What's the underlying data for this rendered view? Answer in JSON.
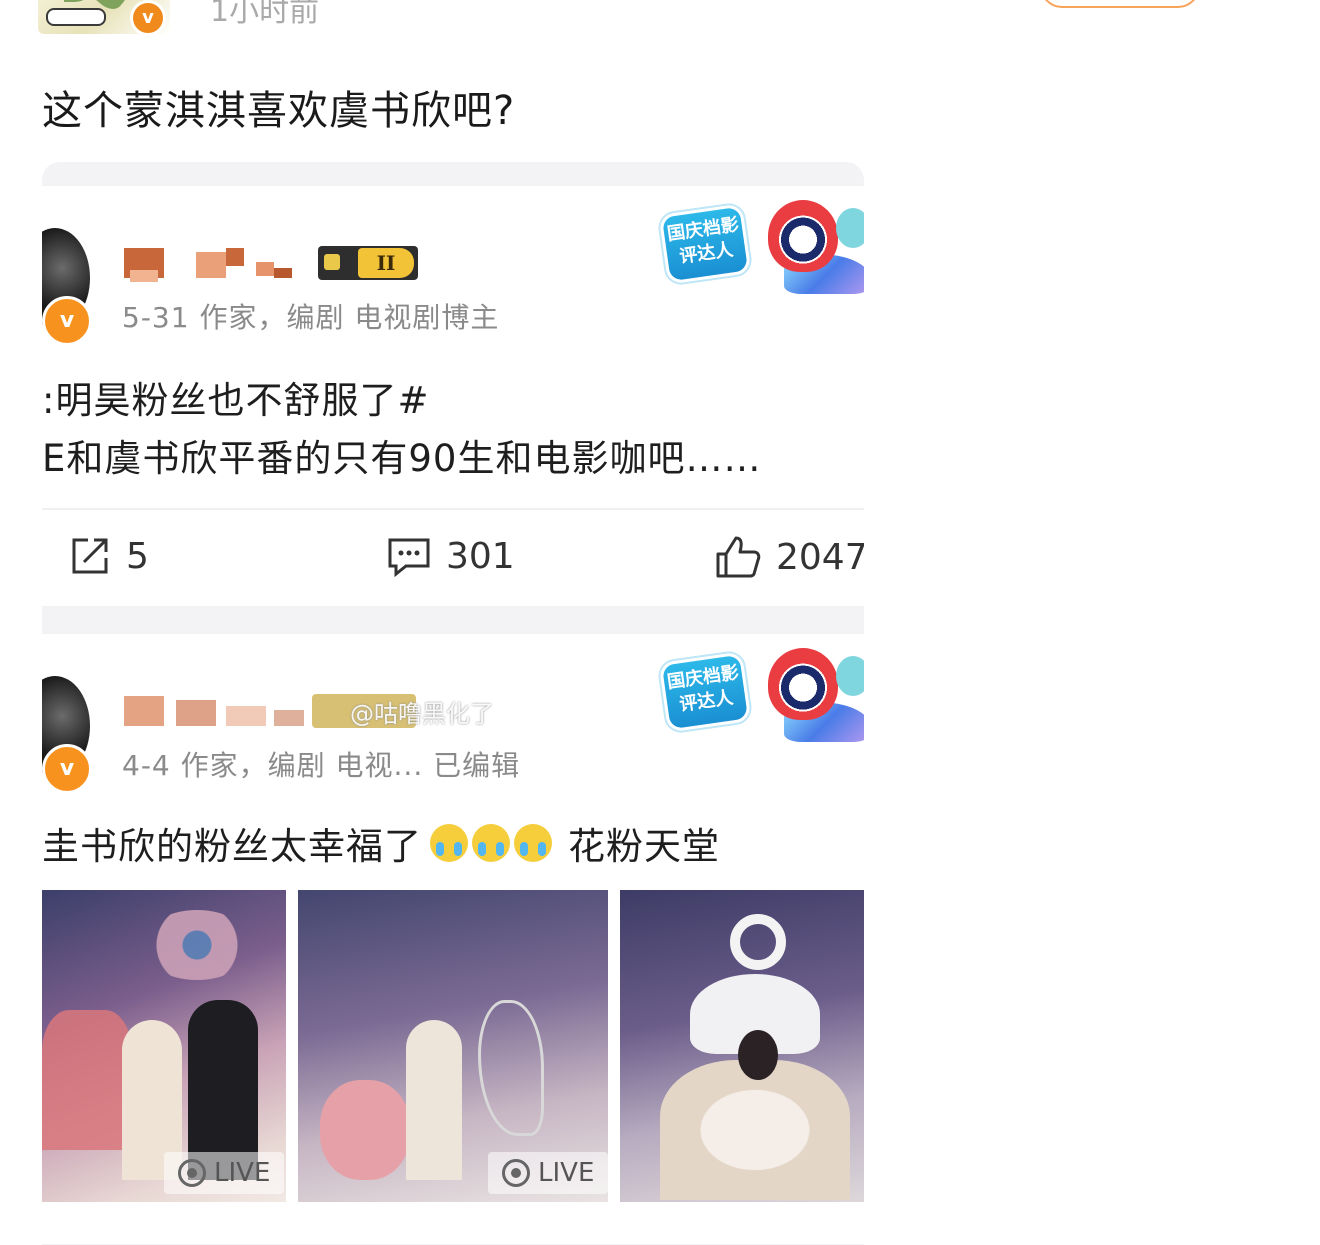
{
  "outer": {
    "time": "1小时前",
    "post_text": "这个蒙淇淇喜欢虞书欣吧?"
  },
  "screenshot": {
    "post1": {
      "meta": "5-31  作家，编剧 电视剧博主",
      "line1": ":明昊粉丝也不舒服了#",
      "line2": "E和虞书欣平番的只有90生和电影咖吧……",
      "badge_text": "国庆档影评达人",
      "level": "II",
      "actions": {
        "repost": "5",
        "comments": "301",
        "likes": "2047"
      }
    },
    "post2": {
      "meta": "4-4  作家，编剧 电视...  已编辑",
      "watermark": "@咕噜黑化了",
      "line1_a": "圭书欣的粉丝太幸福了",
      "line1_b": "花粉天堂",
      "emoji": [
        "crying-emoji",
        "crying-emoji",
        "crying-emoji"
      ],
      "badge_text": "国庆档影评达人",
      "photos": [
        {
          "label": "LIVE"
        },
        {
          "label": "LIVE"
        },
        {
          "label": ""
        }
      ]
    }
  },
  "colors": {
    "accent_orange": "#f08a1c",
    "badge_blue": "#1a8fd3"
  }
}
